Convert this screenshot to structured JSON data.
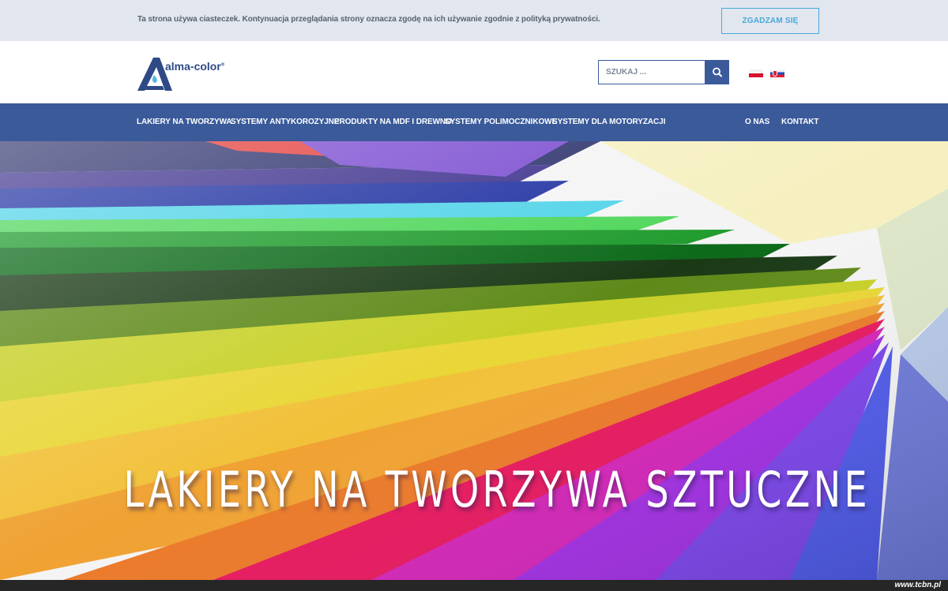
{
  "cookie_bar": {
    "text": "Ta strona używa ciasteczek. Kontynuacja przeglądania strony oznacza zgodę na ich używanie zgodnie z polityką prywatności.",
    "accept_label": "ZGADZAM SIĘ"
  },
  "header": {
    "logo_text": "alma-color",
    "logo_mark": "®",
    "search_placeholder": "SZUKAJ ...",
    "search_icon": "search-icon",
    "languages": [
      "pl",
      "sk"
    ]
  },
  "nav": {
    "items": [
      "LAKIERY NA TWORZYWA",
      "SYSTEMY ANTYKOROZYJNE",
      "PRODUKTY NA MDF I DREWNO",
      "SYSTEMY POLIMOCZNIKOWE",
      "SYSTEMY DLA MOTORYZACJI",
      "O NAS",
      "KONTAKT"
    ]
  },
  "hero": {
    "title": "LAKIERY NA TWORZYWA SZTUCZNE"
  },
  "footer": {
    "watermark": "www.tcbn.pl"
  },
  "colors": {
    "nav_background": "#3a5a9a",
    "cookie_background": "#e1e6ef",
    "accent_button": "#49a8d9",
    "logo_blue": "#2e4a86"
  }
}
